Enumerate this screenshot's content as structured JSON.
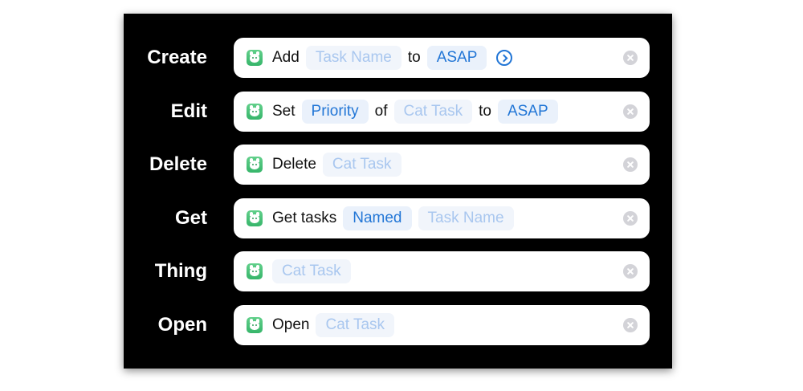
{
  "rows": [
    {
      "label": "Create",
      "items": [
        {
          "kind": "word",
          "text": "Add"
        },
        {
          "kind": "param",
          "text": "Task Name"
        },
        {
          "kind": "word",
          "text": "to"
        },
        {
          "kind": "value",
          "text": "ASAP"
        }
      ],
      "has_expand": true
    },
    {
      "label": "Edit",
      "items": [
        {
          "kind": "word",
          "text": "Set"
        },
        {
          "kind": "value",
          "text": "Priority"
        },
        {
          "kind": "word",
          "text": "of"
        },
        {
          "kind": "param",
          "text": "Cat Task"
        },
        {
          "kind": "word",
          "text": "to"
        },
        {
          "kind": "value",
          "text": "ASAP"
        }
      ]
    },
    {
      "label": "Delete",
      "items": [
        {
          "kind": "word",
          "text": "Delete"
        },
        {
          "kind": "param",
          "text": "Cat Task"
        }
      ]
    },
    {
      "label": "Get",
      "items": [
        {
          "kind": "word",
          "text": "Get tasks"
        },
        {
          "kind": "value",
          "text": "Named"
        },
        {
          "kind": "param",
          "text": "Task Name"
        }
      ]
    },
    {
      "label": "Thing",
      "items": [
        {
          "kind": "param",
          "text": "Cat Task"
        }
      ]
    },
    {
      "label": "Open",
      "items": [
        {
          "kind": "word",
          "text": "Open"
        },
        {
          "kind": "param",
          "text": "Cat Task"
        }
      ]
    }
  ],
  "icons": {
    "app": "cat-app-icon",
    "expand": "chevron-right-circle-icon",
    "clear": "clear-x-icon"
  },
  "colors": {
    "panel_bg": "#000000",
    "card_bg": "#ffffff",
    "value_text": "#2276d6",
    "param_text": "#a9c7ef",
    "app_icon": "#4cc07a"
  }
}
